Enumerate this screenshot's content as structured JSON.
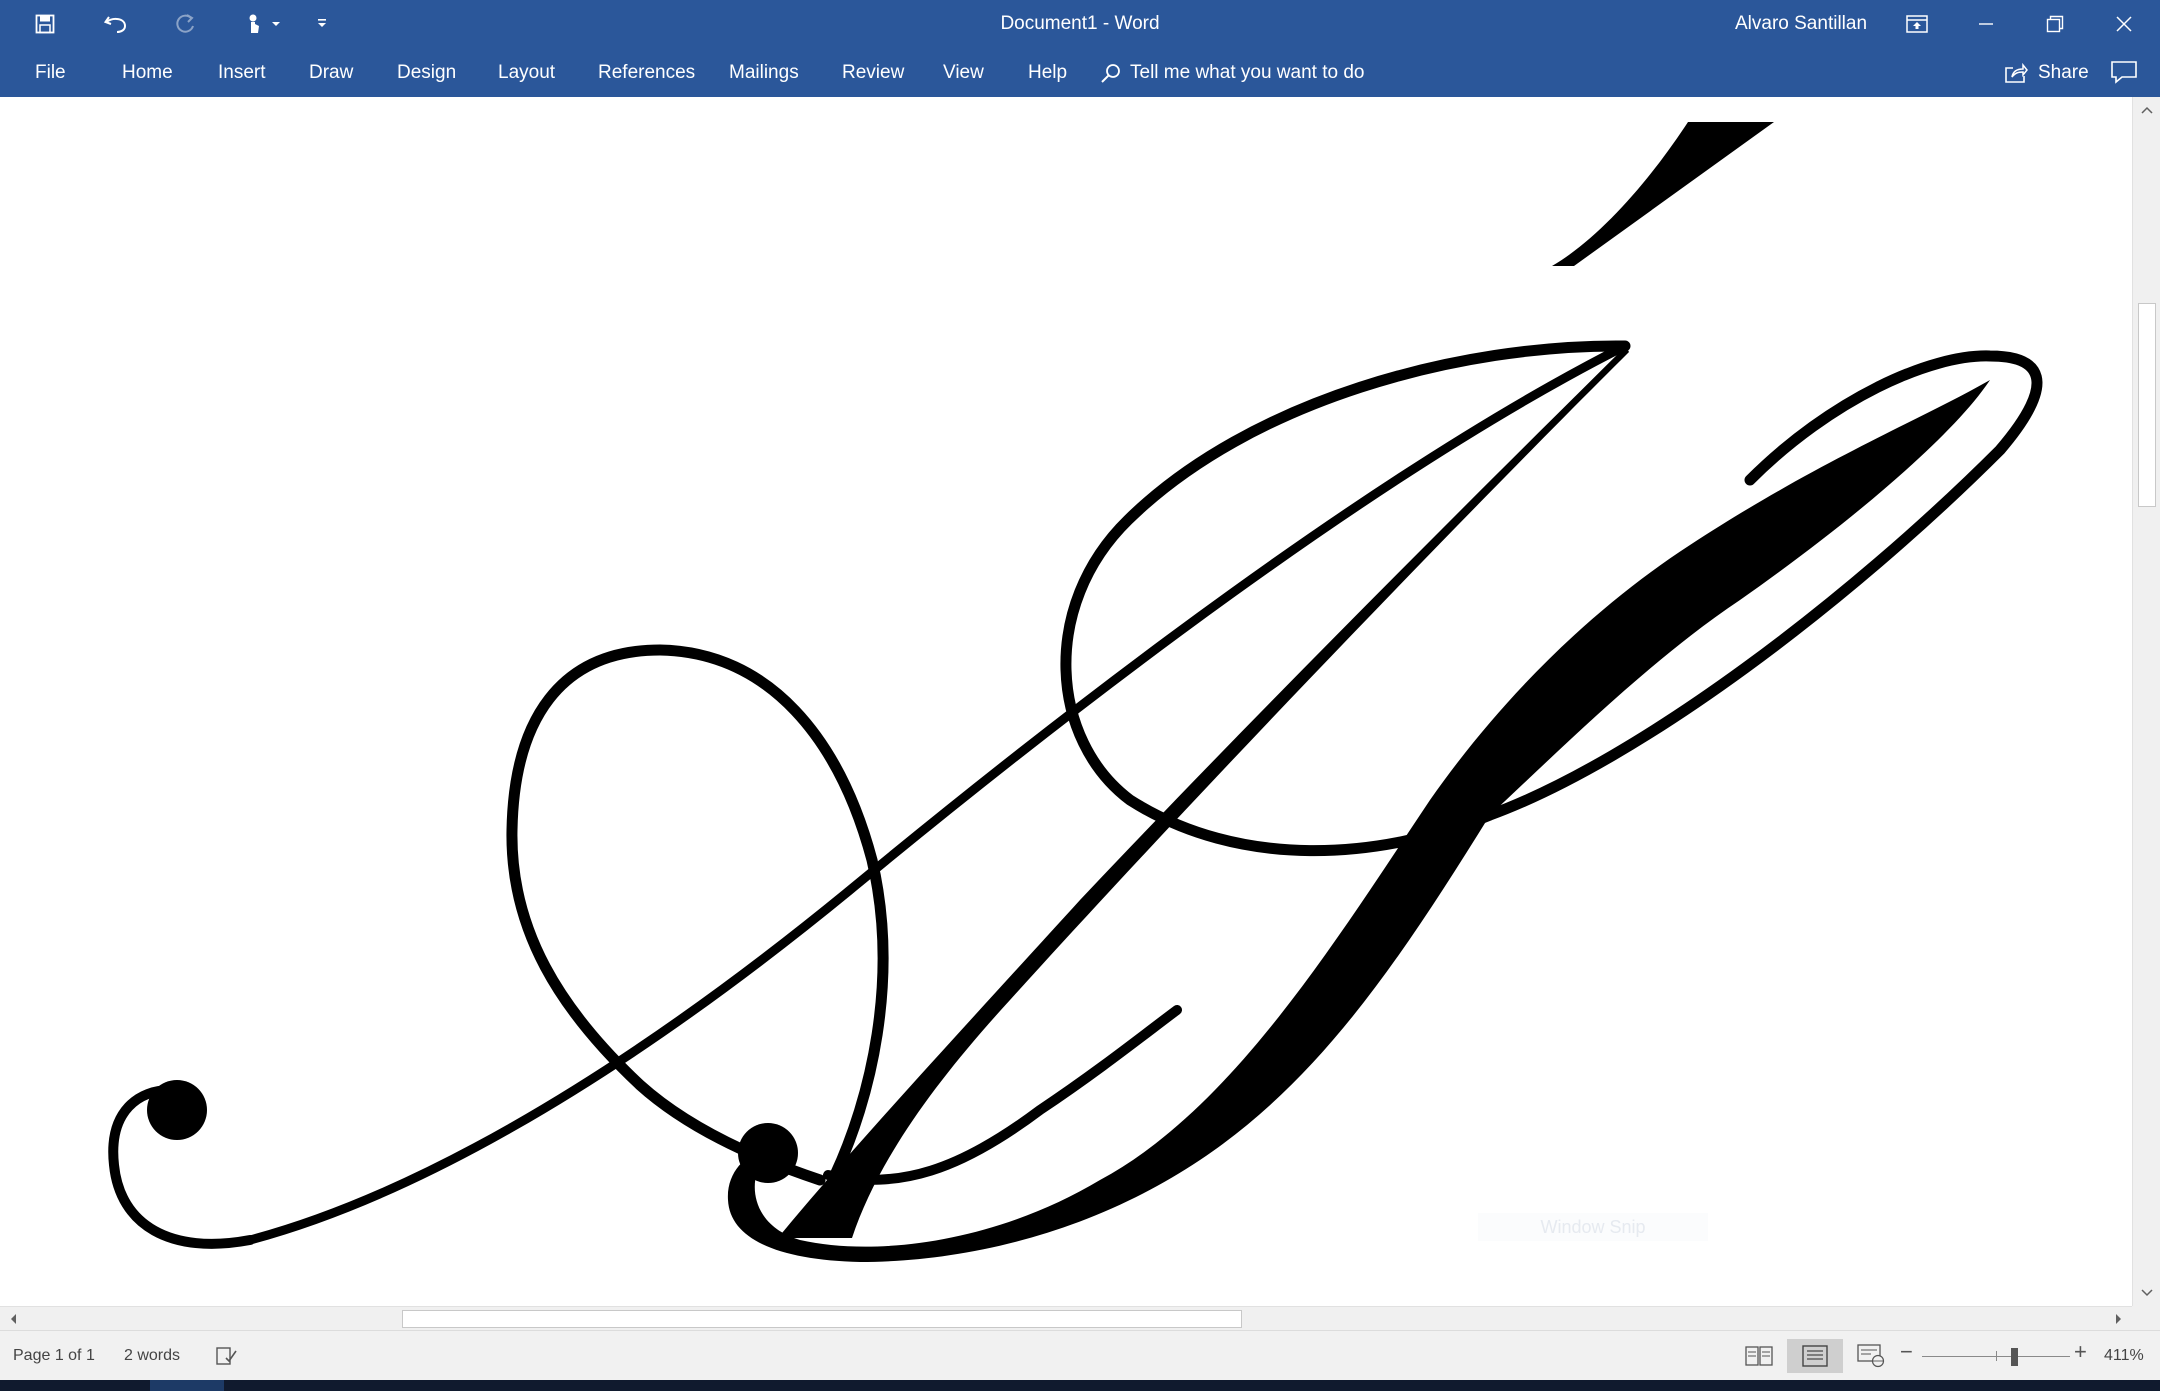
{
  "window": {
    "title": "Document1  -  Word",
    "user": "Alvaro Santillan"
  },
  "quick_access": [
    {
      "icon": "save-icon"
    },
    {
      "icon": "undo-icon"
    },
    {
      "icon": "redo-icon",
      "enabled": false
    },
    {
      "icon": "touch-mode-icon"
    },
    {
      "icon": "customize-qat-icon"
    }
  ],
  "window_controls": [
    {
      "icon": "ribbon-display-options-icon"
    },
    {
      "icon": "minimize-icon"
    },
    {
      "icon": "restore-icon"
    },
    {
      "icon": "close-icon"
    }
  ],
  "ribbon": {
    "tabs": [
      "File",
      "Home",
      "Insert",
      "Draw",
      "Design",
      "Layout",
      "References",
      "Mailings",
      "Review",
      "View",
      "Help"
    ],
    "tell_me": "Tell me what you want to do",
    "share": "Share"
  },
  "document": {
    "watermark": "Window Snip"
  },
  "statusbar": {
    "page": "Page 1 of 1",
    "words": "2 words",
    "zoom": "411%",
    "zoom_position": 0.62
  },
  "colors": {
    "accent": "#2b579a",
    "ink": "#000000",
    "status_bg": "#f1f1f1"
  }
}
